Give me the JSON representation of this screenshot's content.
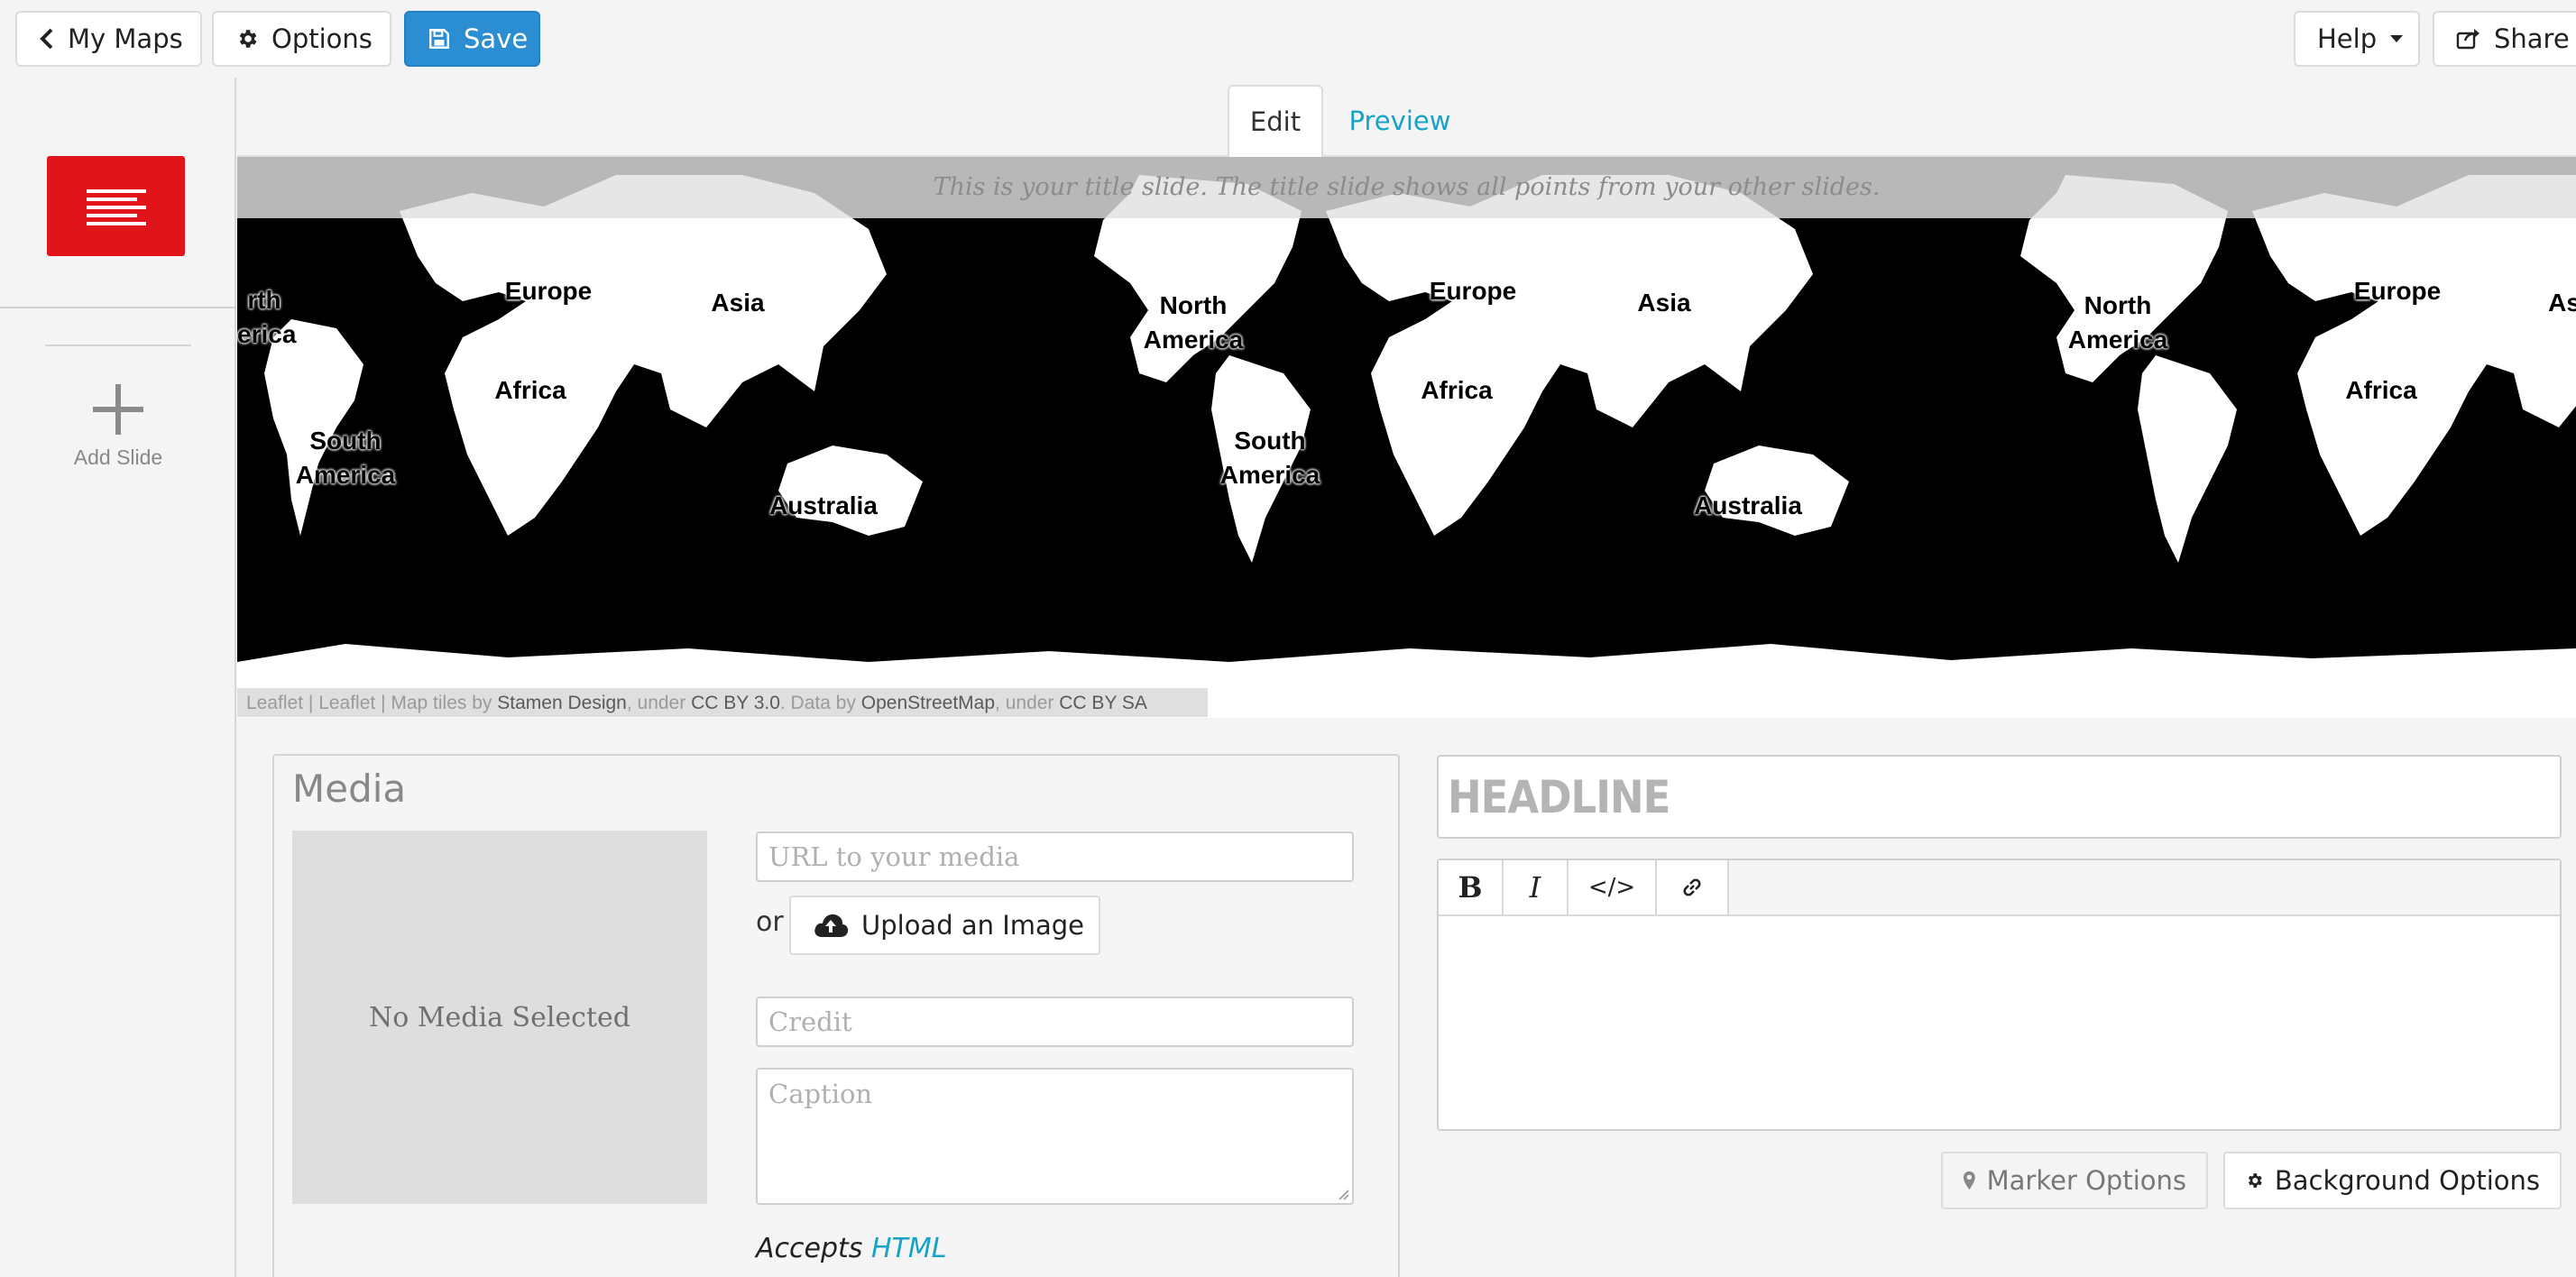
{
  "toolbar": {
    "my_maps_label": "My Maps",
    "options_label": "Options",
    "save_label": "Save",
    "help_label": "Help",
    "share_label": "Share"
  },
  "tabs": [
    {
      "label": "Edit",
      "active": true
    },
    {
      "label": "Preview",
      "active": false
    }
  ],
  "sidebar": {
    "add_slide_label": "Add Slide",
    "title_slide_color": "#e0141a"
  },
  "map": {
    "title_note": "This is your title slide. The title slide shows all points from your other slides.",
    "labels": [
      "rth",
      "erica",
      "Europe",
      "Asia",
      "Africa",
      "South",
      "America",
      "Australia",
      "North",
      "America",
      "Europe",
      "Asia",
      "Africa",
      "South",
      "America",
      "Australia",
      "North",
      "America",
      "Europe",
      "As",
      "Africa"
    ],
    "attribution": {
      "leaflet1": "Leaflet",
      "sep1": " | ",
      "leaflet2": "Leaflet",
      "text1": " | Map tiles by ",
      "stamen": "Stamen Design",
      "text2": ", under ",
      "ccby30": "CC BY 3.0",
      "text3": ". Data by ",
      "osm": "OpenStreetMap",
      "text4": ", under ",
      "ccbysa": "CC BY SA"
    }
  },
  "media": {
    "title": "Media",
    "no_media": "No Media Selected",
    "url_placeholder": "URL to your media",
    "or_text": "or",
    "upload_label": "Upload an Image",
    "credit_placeholder": "Credit",
    "caption_placeholder": "Caption",
    "accepts_text": "Accepts",
    "accepts_link": "HTML"
  },
  "text_editor": {
    "headline_placeholder": "HEADLINE",
    "bold_label": "B",
    "italic_label": "I",
    "code_label": "</>"
  },
  "options": {
    "marker_options_label": "Marker Options",
    "background_options_label": "Background Options"
  },
  "colors": {
    "accent": "#2b8ed2",
    "link": "#17a2c7",
    "slide_red": "#e0141a"
  }
}
